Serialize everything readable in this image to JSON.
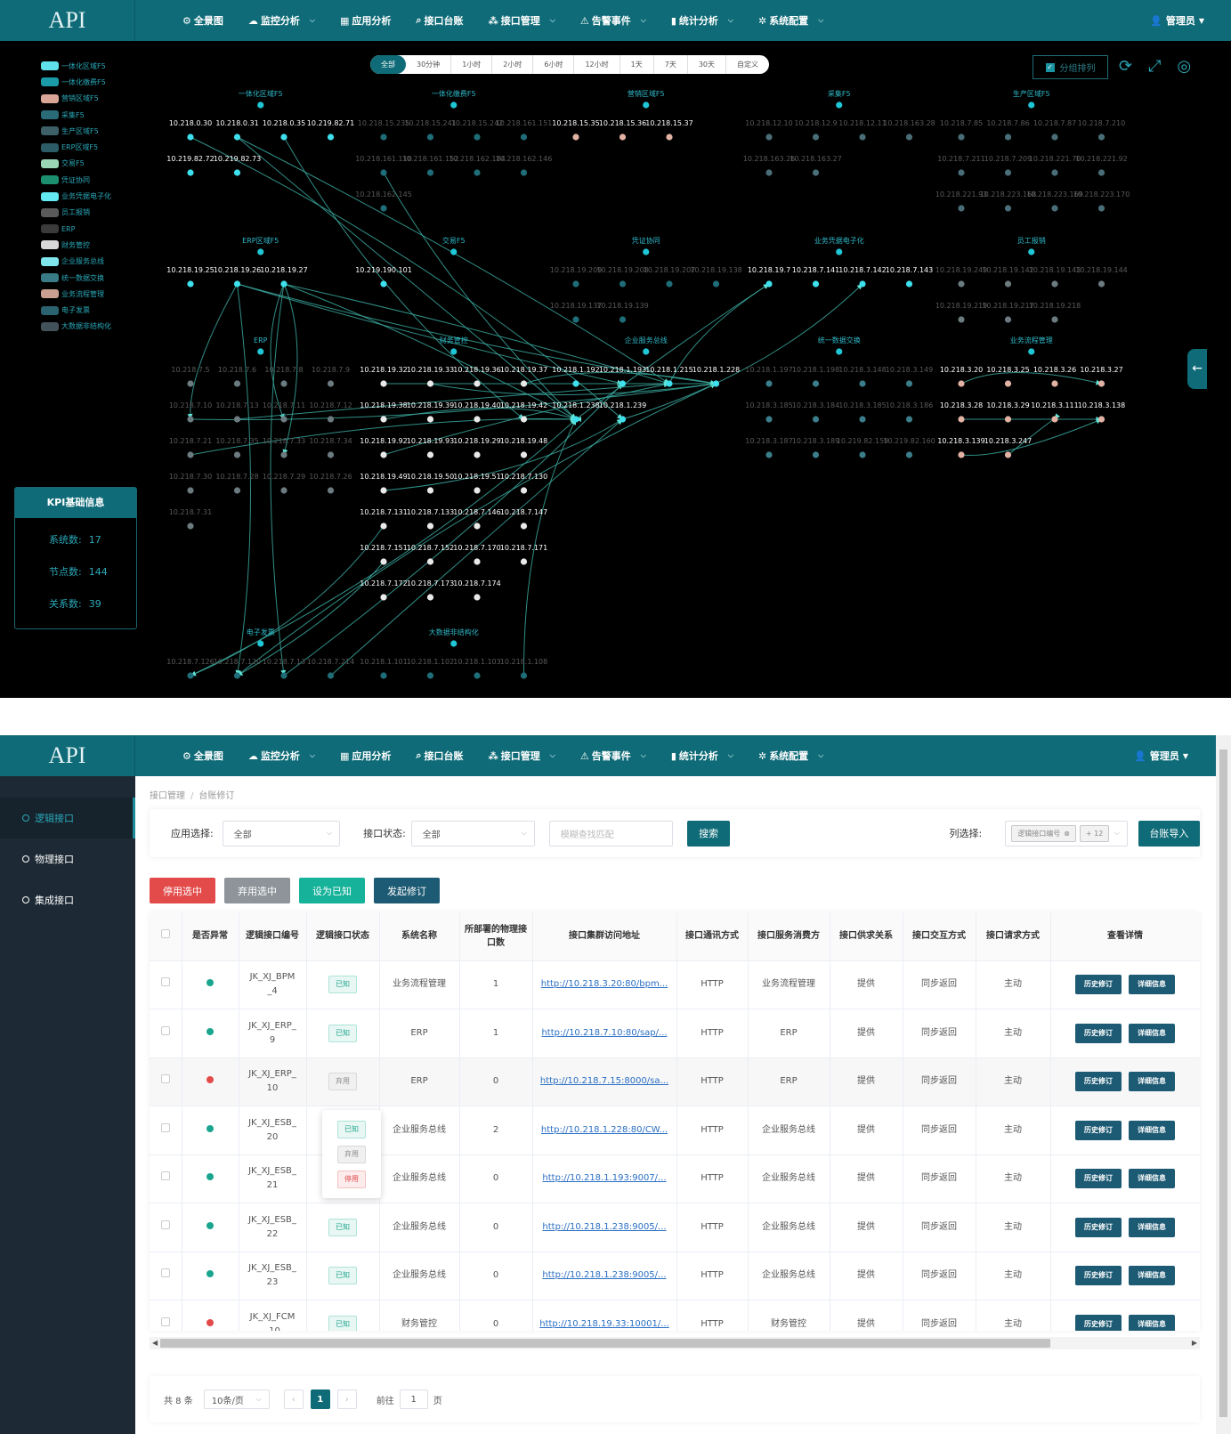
{
  "app": {
    "logo": "API",
    "user": "管理员"
  },
  "nav": [
    {
      "icon": "⚙",
      "icon_name": "gear-circle-icon",
      "label": "全景图",
      "caret": false
    },
    {
      "icon": "☁",
      "icon_name": "monitor-icon",
      "label": "监控分析",
      "caret": true
    },
    {
      "icon": "▦",
      "icon_name": "grid-icon",
      "label": "应用分析",
      "caret": false
    },
    {
      "icon": "⌕",
      "icon_name": "search-icon",
      "label": "接口台账",
      "caret": false
    },
    {
      "icon": "⁂",
      "icon_name": "sitemap-icon",
      "label": "接口管理",
      "caret": true
    },
    {
      "icon": "⚠",
      "icon_name": "warning-icon",
      "label": "告警事件",
      "caret": true
    },
    {
      "icon": "▮",
      "icon_name": "bar-chart-icon",
      "label": "统计分析",
      "caret": true
    },
    {
      "icon": "✲",
      "icon_name": "settings-icon",
      "label": "系统配置",
      "caret": true
    }
  ],
  "topology": {
    "legend": [
      {
        "label": "一体化区域F5",
        "color": "#5fe0ec"
      },
      {
        "label": "一体化缴费F5",
        "color": "#1b9aa8"
      },
      {
        "label": "营销区域F5",
        "color": "#d9a596"
      },
      {
        "label": "采集F5",
        "color": "#2a6b78"
      },
      {
        "label": "生产区域F5",
        "color": "#3d5f68"
      },
      {
        "label": "ERP区域F5",
        "color": "#2c5c66"
      },
      {
        "label": "交易F5",
        "color": "#9ad6b6"
      },
      {
        "label": "凭证协同",
        "color": "#1b8f6e"
      },
      {
        "label": "业务凭据电子化",
        "color": "#62e9f2"
      },
      {
        "label": "员工报销",
        "color": "#5a5a5a"
      },
      {
        "label": "ERP",
        "color": "#3a3a3a"
      },
      {
        "label": "财务管控",
        "color": "#d8d8d8"
      },
      {
        "label": "企业服务总线",
        "color": "#7fe6ee"
      },
      {
        "label": "统一数据交换",
        "color": "#3a7b88"
      },
      {
        "label": "业务流程管理",
        "color": "#caa090"
      },
      {
        "label": "电子发票",
        "color": "#2b6270"
      },
      {
        "label": "大数据非结构化",
        "color": "#43515a"
      }
    ],
    "time_ranges": [
      "全部",
      "30分钟",
      "1小时",
      "2小时",
      "6小时",
      "12小时",
      "1天",
      "7天",
      "30天",
      "自定义"
    ],
    "group_sort_label": "分组排列",
    "kpi": {
      "title": "KPI基础信息",
      "rows": [
        {
          "label": "系统数:",
          "value": "17"
        },
        {
          "label": "节点数:",
          "value": "144"
        },
        {
          "label": "关系数:",
          "value": "39"
        }
      ]
    },
    "groups": [
      {
        "name": "一体化区域F5",
        "rows": [
          [
            "10.218.0.30",
            "10.218.0.31",
            "10.218.0.35",
            "10.219.82.71"
          ],
          [
            "10.219.82.72",
            "10.219.82.73"
          ]
        ]
      },
      {
        "name": "一体化缴费F5",
        "rows": [
          [
            "10.218.15.235",
            "10.218.15.241",
            "10.218.15.242",
            "10.218.161.151"
          ],
          [
            "10.218.161.110",
            "10.218.161.152",
            "10.218.162.184",
            "10.218.162.146"
          ],
          [
            "10.218.162.145"
          ]
        ]
      },
      {
        "name": "营销区域F5",
        "rows": [
          [
            "10.218.15.35",
            "10.218.15.36",
            "10.218.15.37"
          ]
        ]
      },
      {
        "name": "采集F5",
        "rows": [
          [
            "10.218.12.10",
            "10.218.12.9",
            "10.218.12.11",
            "10.218.163.28"
          ],
          [
            "10.218.163.26",
            "10.218.163.27"
          ]
        ]
      },
      {
        "name": "生产区域F5",
        "rows": [
          [
            "10.218.7.85",
            "10.218.7.86",
            "10.218.7.87",
            "10.218.7.210"
          ],
          [
            "10.218.7.211",
            "10.218.7.209",
            "10.218.221.70",
            "10.218.221.92"
          ],
          [
            "10.218.221.93",
            "10.218.223.168",
            "10.218.223.169",
            "10.218.223.170"
          ]
        ]
      },
      {
        "name": "ERP区域F5",
        "rows": [
          [
            "10.218.19.25",
            "10.218.19.26",
            "10.218.19.27"
          ]
        ]
      },
      {
        "name": "交易F5",
        "rows": [
          [
            "10.219.190.101"
          ]
        ]
      },
      {
        "name": "凭证协同",
        "rows": [
          [
            "10.218.19.209",
            "10.218.19.208",
            "10.218.19.207",
            "10.218.19.138"
          ],
          [
            "10.218.19.137",
            "10.218.19.139"
          ]
        ]
      },
      {
        "name": "业务凭据电子化",
        "rows": [
          [
            "10.218.19.7",
            "10.218.7.141",
            "10.218.7.142",
            "10.218.7.143"
          ]
        ]
      },
      {
        "name": "员工报销",
        "rows": [
          [
            "10.218.19.249",
            "10.218.19.142",
            "10.218.19.143",
            "10.218.19.144"
          ],
          [
            "10.218.19.219",
            "10.218.19.217",
            "10.218.19.218"
          ]
        ]
      },
      {
        "name": "ERP",
        "rows": [
          [
            "10.218.7.5",
            "10.218.7.6",
            "10.218.7.8",
            "10.218.7.9"
          ],
          [
            "10.218.7.10",
            "10.218.7.13",
            "10.218.7.11",
            "10.218.7.12"
          ],
          [
            "10.218.7.21",
            "10.218.7.35",
            "10.218.7.33",
            "10.218.7.34"
          ],
          [
            "10.218.7.30",
            "10.218.7.28",
            "10.218.7.29",
            "10.218.7.26"
          ],
          [
            "10.218.7.31"
          ]
        ]
      },
      {
        "name": "财务管控",
        "rows": [
          [
            "10.218.19.32",
            "10.218.19.33",
            "10.218.19.36",
            "10.218.19.37"
          ],
          [
            "10.218.19.38",
            "10.218.19.39",
            "10.218.19.40",
            "10.218.19.42"
          ],
          [
            "10.218.19.92",
            "10.218.19.93",
            "10.218.19.29",
            "10.218.19.48"
          ],
          [
            "10.218.19.49",
            "10.218.19.50",
            "10.218.19.51",
            "10.218.7.130"
          ],
          [
            "10.218.7.131",
            "10.218.7.133",
            "10.218.7.146",
            "10.218.7.147"
          ],
          [
            "10.218.7.151",
            "10.218.7.152",
            "10.218.7.170",
            "10.218.7.171"
          ],
          [
            "10.218.7.172",
            "10.218.7.173",
            "10.218.7.174"
          ]
        ]
      },
      {
        "name": "企业服务总线",
        "rows": [
          [
            "10.218.1.192",
            "10.218.1.193",
            "10.218.1.215",
            "10.218.1.228"
          ],
          [
            "10.218.1.238",
            "10.218.1.239"
          ]
        ]
      },
      {
        "name": "统一数据交换",
        "rows": [
          [
            "10.218.1.197",
            "10.218.1.198",
            "10.218.3.148",
            "10.218.3.149"
          ],
          [
            "10.218.3.185",
            "10.218.3.184",
            "10.218.3.185",
            "10.218.3.186"
          ],
          [
            "10.218.3.187",
            "10.218.3.189",
            "10.219.82.159",
            "10.219.82.160"
          ]
        ]
      },
      {
        "name": "业务流程管理",
        "rows": [
          [
            "10.218.3.20",
            "10.218.3.25",
            "10.218.3.26",
            "10.218.3.27"
          ],
          [
            "10.218.3.28",
            "10.218.3.29",
            "10.218.3.111",
            "10.218.3.138"
          ],
          [
            "10.218.3.139",
            "10.218.3.247"
          ]
        ]
      },
      {
        "name": "电子发票",
        "rows": [
          [
            "10.218.7.126",
            "10.218.7.120",
            "10.218.7.13",
            "10.218.7.214"
          ]
        ]
      },
      {
        "name": "大数据非结构化",
        "rows": [
          [
            "10.218.1.101",
            "10.218.1.102",
            "10.218.1.103",
            "10.218.1.108"
          ]
        ]
      }
    ]
  },
  "ledger": {
    "sidebar": [
      {
        "label": "逻辑接口",
        "active": true
      },
      {
        "label": "物理接口",
        "active": false
      },
      {
        "label": "集成接口",
        "active": false
      }
    ],
    "breadcrumb": [
      "接口管理",
      "台账修订"
    ],
    "filter": {
      "app_label": "应用选择:",
      "app_value": "全部",
      "status_label": "接口状态:",
      "status_value": "全部",
      "search_placeholder": "模糊查找匹配",
      "search_btn": "搜索",
      "col_label": "列选择:",
      "col_tag": "逻辑接口编号",
      "col_more": "+ 12",
      "import_btn": "台账导入"
    },
    "actions": [
      {
        "label": "停用选中",
        "style": "red"
      },
      {
        "label": "弃用选中",
        "style": "gray"
      },
      {
        "label": "设为已知",
        "style": "green"
      },
      {
        "label": "发起修订",
        "style": "dark"
      }
    ],
    "columns": [
      "是否异常",
      "逻辑接口编号",
      "逻辑接口状态",
      "系统名称",
      "所部署的物理接口数",
      "接口集群访问地址",
      "接口通讯方式",
      "接口服务消费方",
      "接口供求关系",
      "接口交互方式",
      "接口请求方式",
      "查看详情"
    ],
    "rows": [
      {
        "abnormal": "#1aa58e",
        "code": "JK_XJ_BPM_4",
        "status": "已知",
        "status_type": "ok",
        "system": "业务流程管理",
        "count": "1",
        "url": "http://10.218.3.20:80/bpm...",
        "comm": "HTTP",
        "consumer": "业务流程管理",
        "relation": "提供",
        "interact": "同步返回",
        "request": "主动"
      },
      {
        "abnormal": "#1aa58e",
        "code": "JK_XJ_ERP_9",
        "status": "已知",
        "status_type": "ok",
        "system": "ERP",
        "count": "1",
        "url": "http://10.218.7.10:80/sap/...",
        "comm": "HTTP",
        "consumer": "ERP",
        "relation": "提供",
        "interact": "同步返回",
        "request": "主动"
      },
      {
        "abnormal": "#e34b4b",
        "code": "JK_XJ_ERP_10",
        "status": "弃用",
        "status_type": "ab",
        "system": "ERP",
        "count": "0",
        "url": "http://10.218.7.15:8000/sa...",
        "comm": "HTTP",
        "consumer": "ERP",
        "relation": "提供",
        "interact": "同步返回",
        "request": "主动"
      },
      {
        "abnormal": "#1aa58e",
        "code": "JK_XJ_ESB_20",
        "status": "",
        "status_type": "",
        "system": "企业服务总线",
        "count": "2",
        "url": "http://10.218.1.228:80/CW...",
        "comm": "HTTP",
        "consumer": "企业服务总线",
        "relation": "提供",
        "interact": "同步返回",
        "request": "主动"
      },
      {
        "abnormal": "#1aa58e",
        "code": "JK_XJ_ESB_21",
        "status": "",
        "status_type": "",
        "system": "企业服务总线",
        "count": "0",
        "url": "http://10.218.1.193:9007/...",
        "comm": "HTTP",
        "consumer": "企业服务总线",
        "relation": "提供",
        "interact": "同步返回",
        "request": "主动"
      },
      {
        "abnormal": "#1aa58e",
        "code": "JK_XJ_ESB_22",
        "status": "已知",
        "status_type": "ok",
        "system": "企业服务总线",
        "count": "0",
        "url": "http://10.218.1.238:9005/...",
        "comm": "HTTP",
        "consumer": "企业服务总线",
        "relation": "提供",
        "interact": "同步返回",
        "request": "主动"
      },
      {
        "abnormal": "#1aa58e",
        "code": "JK_XJ_ESB_23",
        "status": "已知",
        "status_type": "ok",
        "system": "企业服务总线",
        "count": "0",
        "url": "http://10.218.1.238:9005/...",
        "comm": "HTTP",
        "consumer": "企业服务总线",
        "relation": "提供",
        "interact": "同步返回",
        "request": "主动"
      },
      {
        "abnormal": "#e34b4b",
        "code": "JK_XJ_FCM_10",
        "status": "已知",
        "status_type": "ok",
        "system": "财务管控",
        "count": "0",
        "url": "http://10.218.19.33:10001/...",
        "comm": "HTTP",
        "consumer": "财务管控",
        "relation": "提供",
        "interact": "同步返回",
        "request": "主动"
      }
    ],
    "row_buttons": [
      "历史修订",
      "详细信息"
    ],
    "status_dropdown": [
      {
        "label": "已知",
        "type": "ok"
      },
      {
        "label": "弃用",
        "type": "ab"
      },
      {
        "label": "停用",
        "type": "stop"
      }
    ],
    "pager": {
      "total": "共 8 条",
      "size": "10条/页",
      "current": "1",
      "goto_label": "前往",
      "goto_value": "1",
      "page_unit": "页"
    }
  }
}
